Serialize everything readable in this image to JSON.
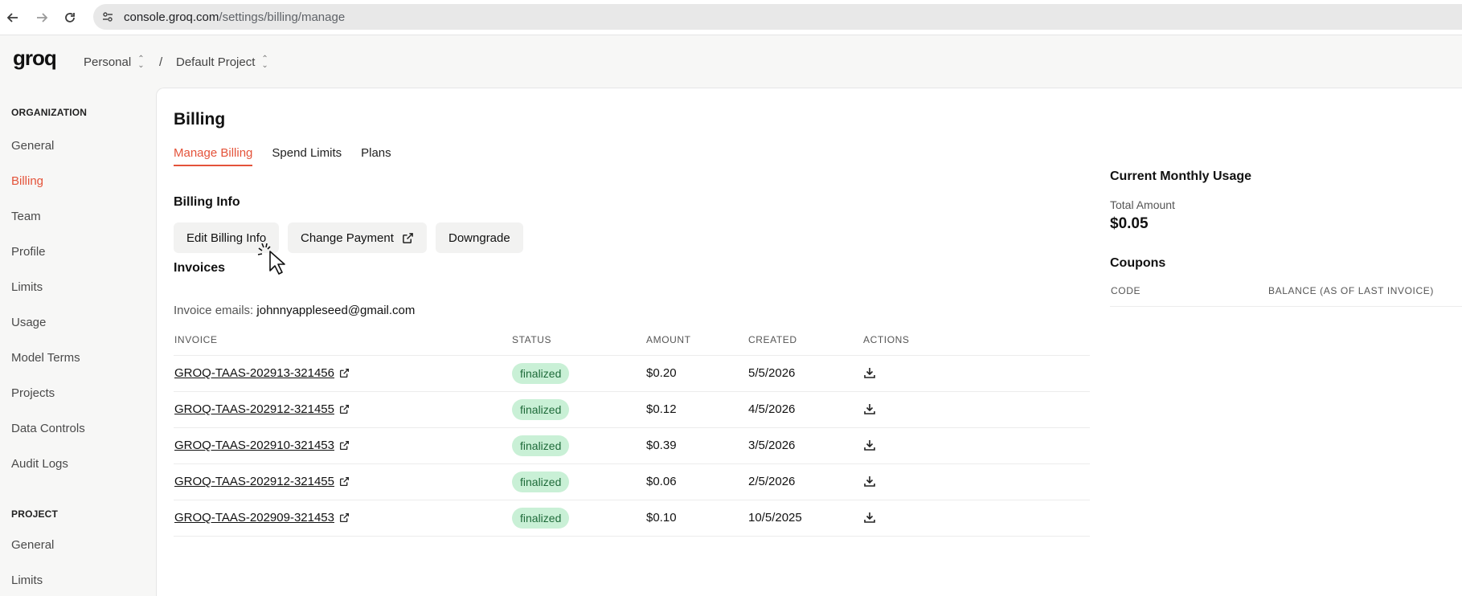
{
  "browser": {
    "url_host": "console.groq.com",
    "url_path": "/settings/billing/manage"
  },
  "header": {
    "logo": "groq",
    "org": "Personal",
    "separator": "/",
    "project": "Default Project"
  },
  "sidebar": {
    "org_section": "ORGANIZATION",
    "org_items": [
      {
        "label": "General"
      },
      {
        "label": "Billing",
        "active": true
      },
      {
        "label": "Team"
      },
      {
        "label": "Profile"
      },
      {
        "label": "Limits"
      },
      {
        "label": "Usage"
      },
      {
        "label": "Model Terms"
      },
      {
        "label": "Projects"
      },
      {
        "label": "Data Controls"
      },
      {
        "label": "Audit Logs"
      }
    ],
    "project_section": "PROJECT",
    "project_items": [
      {
        "label": "General"
      },
      {
        "label": "Limits"
      }
    ]
  },
  "main": {
    "title": "Billing",
    "tabs": [
      {
        "label": "Manage Billing",
        "active": true
      },
      {
        "label": "Spend Limits"
      },
      {
        "label": "Plans"
      }
    ],
    "billing_info": {
      "heading": "Billing Info",
      "edit_label": "Edit Billing Info",
      "change_payment_label": "Change Payment",
      "downgrade_label": "Downgrade"
    },
    "invoices": {
      "heading": "Invoices",
      "emails_label": "Invoice emails:",
      "emails_value": "johnnyappleseed@gmail.com",
      "columns": [
        "INVOICE",
        "STATUS",
        "AMOUNT",
        "CREATED",
        "ACTIONS"
      ],
      "rows": [
        {
          "id": "GROQ-TAAS-202913-321456",
          "status": "finalized",
          "amount": "$0.20",
          "created": "5/5/2026"
        },
        {
          "id": "GROQ-TAAS-202912-321455",
          "status": "finalized",
          "amount": "$0.12",
          "created": "4/5/2026"
        },
        {
          "id": "GROQ-TAAS-202910-321453",
          "status": "finalized",
          "amount": "$0.39",
          "created": "3/5/2026"
        },
        {
          "id": "GROQ-TAAS-202912-321455",
          "status": "finalized",
          "amount": "$0.06",
          "created": "2/5/2026"
        },
        {
          "id": "GROQ-TAAS-202909-321453",
          "status": "finalized",
          "amount": "$0.10",
          "created": "10/5/2025"
        }
      ]
    },
    "usage": {
      "heading": "Current Monthly Usage",
      "total_label": "Total Amount",
      "total_value": "$0.05"
    },
    "coupons": {
      "heading": "Coupons",
      "columns": [
        "CODE",
        "BALANCE (AS OF LAST INVOICE)"
      ]
    }
  },
  "colors": {
    "accent": "#e4533a",
    "badge_bg": "#c9f0d6",
    "badge_text": "#1f6b3a"
  }
}
